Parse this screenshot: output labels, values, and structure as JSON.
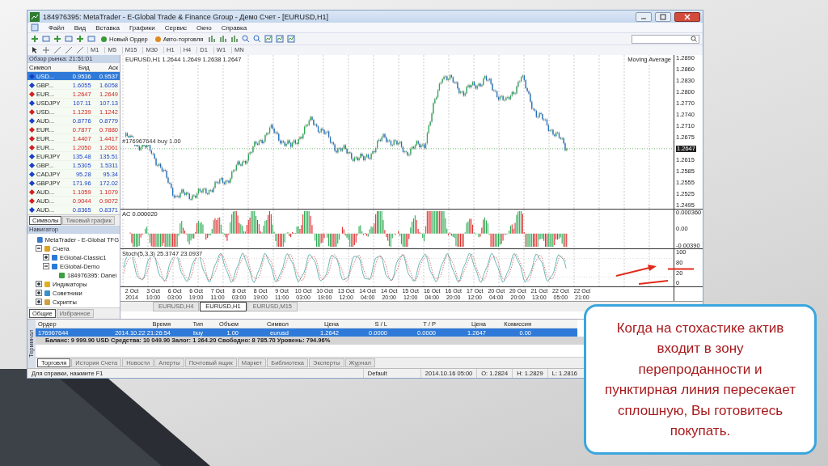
{
  "window": {
    "title": "184976395: MetaTrader - E-Global Trade & Finance Group - Демо Счет - [EURUSD,H1]"
  },
  "menu": [
    "Файл",
    "Вид",
    "Вставка",
    "Графики",
    "Сервис",
    "Окно",
    "Справка"
  ],
  "toolbar": {
    "buttons": [
      {
        "label": "Новый Ордер",
        "kind": "order"
      },
      {
        "label": "Авто-торговля",
        "kind": "auto"
      }
    ]
  },
  "timeframes": [
    "M1",
    "M5",
    "M15",
    "M30",
    "H1",
    "H4",
    "D1",
    "W1",
    "MN"
  ],
  "market_watch": {
    "title": "Обзор рынка: 21:51:01",
    "columns": [
      "Символ",
      "Бид",
      "Аск"
    ],
    "rows": [
      {
        "symbol": "USD...",
        "bid": "0.9536",
        "ask": "0.9537",
        "color": "#1a3fc8",
        "selected": true
      },
      {
        "symbol": "GBP...",
        "bid": "1.6055",
        "ask": "1.6058",
        "color": "#1a3fc8",
        "selected": false
      },
      {
        "symbol": "EUR...",
        "bid": "1.2647",
        "ask": "1.2649",
        "color": "#d42020",
        "selected": false
      },
      {
        "symbol": "USDJPY",
        "bid": "107.11",
        "ask": "107.13",
        "color": "#1a3fc8",
        "selected": false
      },
      {
        "symbol": "USD...",
        "bid": "1.1239",
        "ask": "1.1242",
        "color": "#d42020",
        "selected": false
      },
      {
        "symbol": "AUD...",
        "bid": "0.8776",
        "ask": "0.8779",
        "color": "#1a3fc8",
        "selected": false
      },
      {
        "symbol": "EUR...",
        "bid": "0.7877",
        "ask": "0.7880",
        "color": "#d42020",
        "selected": false
      },
      {
        "symbol": "EUR...",
        "bid": "1.4407",
        "ask": "1.4417",
        "color": "#d42020",
        "selected": false
      },
      {
        "symbol": "EUR...",
        "bid": "1.2050",
        "ask": "1.2061",
        "color": "#d42020",
        "selected": false
      },
      {
        "symbol": "EURJPY",
        "bid": "135.48",
        "ask": "135.51",
        "color": "#1a3fc8",
        "selected": false
      },
      {
        "symbol": "GBP...",
        "bid": "1.5305",
        "ask": "1.5311",
        "color": "#1a3fc8",
        "selected": false
      },
      {
        "symbol": "CADJPY",
        "bid": "95.28",
        "ask": "95.34",
        "color": "#1a3fc8",
        "selected": false
      },
      {
        "symbol": "GBPJPY",
        "bid": "171.96",
        "ask": "172.02",
        "color": "#1a3fc8",
        "selected": false
      },
      {
        "symbol": "AUD...",
        "bid": "1.1059",
        "ask": "1.1079",
        "color": "#d42020",
        "selected": false
      },
      {
        "symbol": "AUD...",
        "bid": "0.9044",
        "ask": "0.9072",
        "color": "#d42020",
        "selected": false
      },
      {
        "symbol": "AUD...",
        "bid": "0.8365",
        "ask": "0.8371",
        "color": "#1a3fc8",
        "selected": false
      }
    ],
    "tabs": [
      {
        "label": "Символы",
        "selected": true
      },
      {
        "label": "Тиковый график",
        "selected": false
      }
    ]
  },
  "navigator": {
    "title": "Навигатор",
    "items": [
      {
        "label": "MetaTrader - E-Global TFG",
        "kind": "app",
        "children": [
          {
            "label": "Счета",
            "kind": "folder",
            "expanded": true,
            "children": [
              {
                "label": "EGlobal-Classic1",
                "kind": "server",
                "expanded": false
              },
              {
                "label": "EGlobal-Demo",
                "kind": "server",
                "expanded": true,
                "children": [
                  {
                    "label": "184976395: Danei",
                    "kind": "account"
                  }
                ]
              }
            ]
          },
          {
            "label": "Индикаторы",
            "kind": "indicator",
            "expanded": false
          },
          {
            "label": "Советники",
            "kind": "expert",
            "expanded": false
          },
          {
            "label": "Скрипты",
            "kind": "script",
            "expanded": false
          }
        ]
      }
    ],
    "tabs": [
      {
        "label": "Общие",
        "selected": true
      },
      {
        "label": "Избранное",
        "selected": false
      }
    ]
  },
  "chart": {
    "header": "EURUSD,H1  1.2644 1.2649 1.2638 1.2647",
    "indicator_label": "Moving Average",
    "order_line": "#176967644 buy 1.00",
    "price_ticks": [
      {
        "label": "1.2890",
        "kind": "tick"
      },
      {
        "label": "1.2860",
        "kind": "tick"
      },
      {
        "label": "1.2830",
        "kind": "tick"
      },
      {
        "label": "1.2800",
        "kind": "tick"
      },
      {
        "label": "1.2770",
        "kind": "tick"
      },
      {
        "label": "1.2740",
        "kind": "tick"
      },
      {
        "label": "1.2710",
        "kind": "tick"
      },
      {
        "label": "1.2675",
        "kind": "tick"
      },
      {
        "label": "1.2647",
        "kind": "current"
      },
      {
        "label": "1.2615",
        "kind": "tick"
      },
      {
        "label": "1.2585",
        "kind": "tick"
      },
      {
        "label": "1.2555",
        "kind": "tick"
      },
      {
        "label": "1.2525",
        "kind": "tick"
      },
      {
        "label": "1.2495",
        "kind": "tick"
      }
    ],
    "ac_label": "AC 0.000020",
    "ac_ticks": [
      "0.000360",
      "0.00",
      "-0.00390"
    ],
    "stoch_label": "Stoch(5,3,3) 25.3747 23.0937",
    "stoch_ticks": [
      "100",
      "80",
      "20",
      "0"
    ],
    "time_ticks": [
      "2 Oct 2014",
      "3 Oct 10:00",
      "6 Oct 03:00",
      "6 Oct 19:00",
      "7 Oct 11:00",
      "8 Oct 03:00",
      "8 Oct 19:00",
      "9 Oct 11:00",
      "10 Oct 03:00",
      "10 Oct 19:00",
      "13 Oct 12:00",
      "14 Oct 04:00",
      "14 Oct 20:00",
      "15 Oct 12:00",
      "16 Oct 04:00",
      "16 Oct 20:00",
      "17 Oct 12:00",
      "20 Oct 04:00",
      "20 Oct 20:00",
      "21 Oct 13:00",
      "22 Oct 05:00",
      "22 Oct 21:00"
    ],
    "tabs": [
      {
        "label": "EURUSD,H4",
        "selected": false
      },
      {
        "label": "EURUSD,H1",
        "selected": true
      },
      {
        "label": "EURUSD,M15",
        "selected": false
      }
    ]
  },
  "terminal": {
    "title": "Терминал",
    "columns": [
      "Ордер",
      "Время",
      "Тип",
      "Объем",
      "Символ",
      "Цена",
      "S / L",
      "T / P",
      "Цена",
      "Комиссия"
    ],
    "rows": [
      {
        "cells": [
          "176967644",
          "2014.10.22 21:26:54",
          "buy",
          "1.00",
          "eurusd",
          "1.2642",
          "0.0000",
          "0.0000",
          "1.2647",
          "0.00"
        ],
        "selected": true
      }
    ],
    "balance": "Баланс: 9 999.90 USD  Средства: 10 049.90  Залог: 1 264.20  Свободно: 8 785.70  Уровень: 794.96%",
    "tabs": [
      {
        "label": "Торговля",
        "selected": true
      },
      {
        "label": "История Счета",
        "selected": false
      },
      {
        "label": "Новости",
        "selected": false
      },
      {
        "label": "Алерты",
        "selected": false
      },
      {
        "label": "Почтовый ящик",
        "selected": false
      },
      {
        "label": "Маркет",
        "selected": false
      },
      {
        "label": "Библиотека",
        "selected": false
      },
      {
        "label": "Эксперты",
        "selected": false
      },
      {
        "label": "Журнал",
        "selected": false
      }
    ]
  },
  "status_bar": [
    "Для справки, нажмите F1",
    "Default",
    "2014.10.16 05:00",
    "O: 1.2824",
    "H: 1.2829",
    "L: 1.2816"
  ],
  "callout": "Когда на стохастике актив входит в зону перепроданности и пунктирная линия пересекает сплошную, Вы готовитесь покупать."
}
